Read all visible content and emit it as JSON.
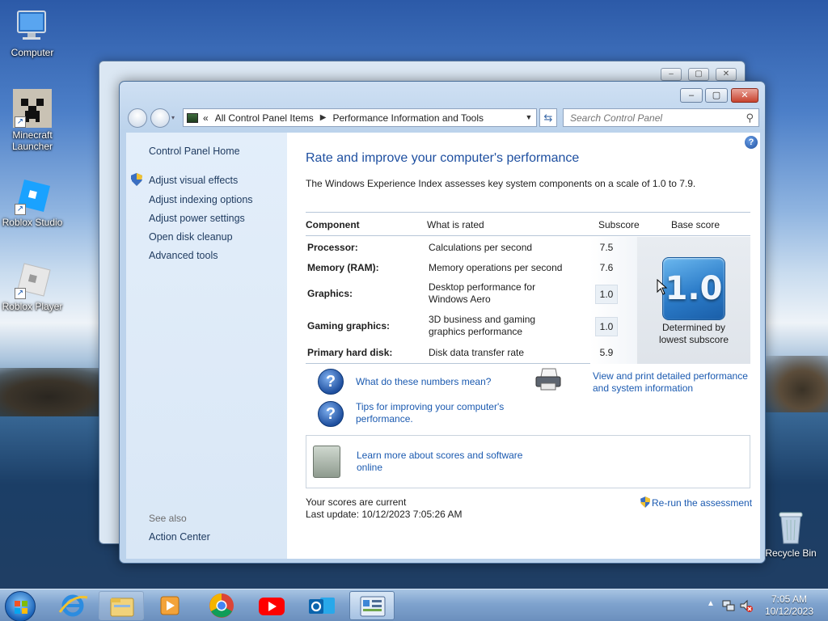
{
  "desktop": {
    "icons": [
      {
        "label": "Computer",
        "icon": "computer-icon"
      },
      {
        "label": "Minecraft\nLauncher",
        "label_line1": "Minecraft",
        "label_line2": "Launcher",
        "icon": "minecraft-icon"
      },
      {
        "label": "Roblox Studio",
        "icon": "roblox-studio-icon"
      },
      {
        "label": "Roblox Player",
        "icon": "roblox-player-icon"
      },
      {
        "label": "Recycle Bin",
        "icon": "recycle-bin-icon"
      }
    ]
  },
  "window": {
    "address": {
      "overflow": "«",
      "crumbs": [
        "All Control Panel Items",
        "Performance Information and Tools"
      ]
    },
    "search_placeholder": "Search Control Panel",
    "sidebar": {
      "home": "Control Panel Home",
      "tasks": [
        "Adjust visual effects",
        "Adjust indexing options",
        "Adjust power settings",
        "Open disk cleanup",
        "Advanced tools"
      ],
      "see_also_heading": "See also",
      "see_also": [
        "Action Center"
      ]
    },
    "main": {
      "title": "Rate and improve your computer's performance",
      "description": "The Windows Experience Index assesses key system components on a scale of 1.0 to 7.9.",
      "table": {
        "headers": {
          "component": "Component",
          "rated": "What is rated",
          "subscore": "Subscore",
          "base": "Base score"
        },
        "rows": [
          {
            "component": "Processor:",
            "rated": "Calculations per second",
            "subscore": "7.5"
          },
          {
            "component": "Memory (RAM):",
            "rated": "Memory operations per second",
            "subscore": "7.6"
          },
          {
            "component": "Graphics:",
            "rated": "Desktop performance for Windows Aero",
            "subscore": "1.0"
          },
          {
            "component": "Gaming graphics:",
            "rated": "3D business and gaming graphics performance",
            "subscore": "1.0"
          },
          {
            "component": "Primary hard disk:",
            "rated": "Disk data transfer rate",
            "subscore": "5.9"
          }
        ],
        "base_score": "1.0",
        "base_caption_line1": "Determined by",
        "base_caption_line2": "lowest subscore"
      },
      "links": {
        "numbers": "What do these numbers mean?",
        "tips": "Tips for improving your computer's performance.",
        "print": "View and print detailed performance and system information",
        "learn": "Learn more about scores and software online",
        "rerun": "Re-run the assessment"
      },
      "status_line1": "Your scores are current",
      "status_line2": "Last update: 10/12/2023 7:05:26 AM"
    }
  },
  "taskbar": {
    "apps": [
      "internet-explorer-icon",
      "file-explorer-icon",
      "media-player-icon",
      "chrome-icon",
      "youtube-icon",
      "outlook-icon",
      "control-panel-icon"
    ],
    "time": "7:05 AM",
    "date": "10/12/2023"
  },
  "colors": {
    "link": "#1b5ab0",
    "title": "#1e4fa0",
    "taskbar": "#7fa3ce"
  }
}
